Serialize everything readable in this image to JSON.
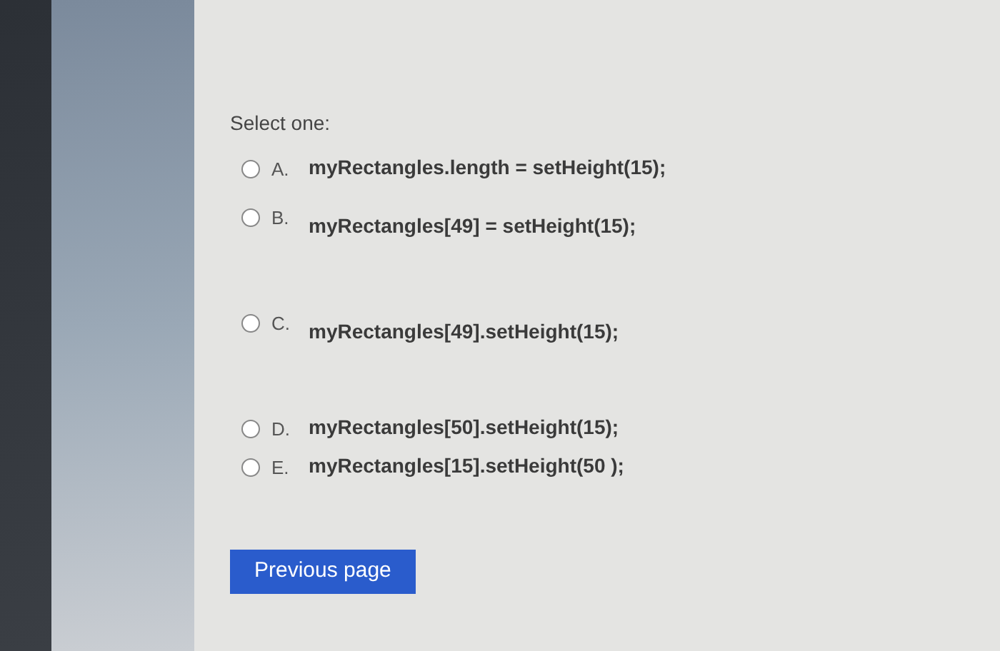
{
  "question": {
    "prompt": "Select one:",
    "options": [
      {
        "letter": "A.",
        "text": "myRectangles.length = setHeight(15);",
        "selected": false
      },
      {
        "letter": "B.",
        "text": "myRectangles[49] = setHeight(15);",
        "selected": false
      },
      {
        "letter": "C.",
        "text": "myRectangles[49].setHeight(15);",
        "selected": false
      },
      {
        "letter": "D.",
        "text": "myRectangles[50].setHeight(15);",
        "selected": false
      },
      {
        "letter": "E.",
        "text": "myRectangles[15].setHeight(50 );",
        "selected": false
      }
    ]
  },
  "buttons": [
    {
      "label": "Previous page"
    }
  ]
}
